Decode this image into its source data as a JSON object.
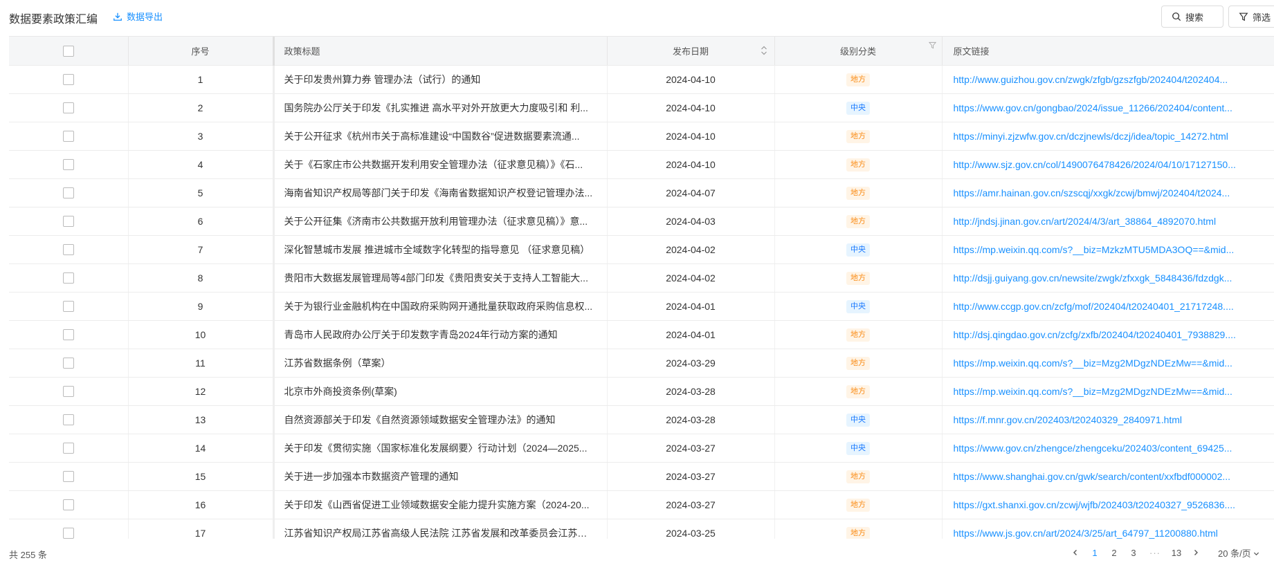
{
  "header": {
    "title": "数据要素政策汇编",
    "export_label": "数据导出",
    "search_label": "搜索",
    "filter_label": "筛选"
  },
  "columns": {
    "no": "序号",
    "title": "政策标题",
    "date": "发布日期",
    "level": "级别分类",
    "link": "原文链接"
  },
  "colors": {
    "accent": "#1890ff",
    "local_text": "#fa8c16",
    "local_bg": "#fff4e6",
    "central_text": "#1677ff",
    "central_bg": "#e6f4ff"
  },
  "rows": [
    {
      "no": "1",
      "title": "关于印发贵州算力券 管理办法（试行）的通知",
      "date": "2024-04-10",
      "level": "地方",
      "link": "http://www.guizhou.gov.cn/zwgk/zfgb/gzszfgb/202404/t202404..."
    },
    {
      "no": "2",
      "title": "国务院办公厅关于印发《扎实推进 高水平对外开放更大力度吸引和 利...",
      "date": "2024-04-10",
      "level": "中央",
      "link": "https://www.gov.cn/gongbao/2024/issue_11266/202404/content..."
    },
    {
      "no": "3",
      "title": "关于公开征求《杭州市关于高标准建设“中国数谷”促进数据要素流通...",
      "date": "2024-04-10",
      "level": "地方",
      "link": "https://minyi.zjzwfw.gov.cn/dczjnewls/dczj/idea/topic_14272.html"
    },
    {
      "no": "4",
      "title": "关于《石家庄市公共数据开发利用安全管理办法（征求意见稿）》《石...",
      "date": "2024-04-10",
      "level": "地方",
      "link": "http://www.sjz.gov.cn/col/1490076478426/2024/04/10/17127150..."
    },
    {
      "no": "5",
      "title": "海南省知识产权局等部门关于印发《海南省数据知识产权登记管理办法...",
      "date": "2024-04-07",
      "level": "地方",
      "link": "https://amr.hainan.gov.cn/szscqj/xxgk/zcwj/bmwj/202404/t2024..."
    },
    {
      "no": "6",
      "title": "关于公开征集《济南市公共数据开放利用管理办法（征求意见稿）》意...",
      "date": "2024-04-03",
      "level": "地方",
      "link": "http://jndsj.jinan.gov.cn/art/2024/4/3/art_38864_4892070.html"
    },
    {
      "no": "7",
      "title": "深化智慧城市发展 推进城市全域数字化转型的指导意见 （征求意见稿）",
      "date": "2024-04-02",
      "level": "中央",
      "link": "https://mp.weixin.qq.com/s?__biz=MzkzMTU5MDA3OQ==&mid..."
    },
    {
      "no": "8",
      "title": "贵阳市大数据发展管理局等4部门印发《贵阳贵安关于支持人工智能大...",
      "date": "2024-04-02",
      "level": "地方",
      "link": "http://dsjj.guiyang.gov.cn/newsite/zwgk/zfxxgk_5848436/fdzdgk..."
    },
    {
      "no": "9",
      "title": "关于为银行业金融机构在中国政府采购网开通批量获取政府采购信息权...",
      "date": "2024-04-01",
      "level": "中央",
      "link": "http://www.ccgp.gov.cn/zcfg/mof/202404/t20240401_21717248...."
    },
    {
      "no": "10",
      "title": "青岛市人民政府办公厅关于印发数字青岛2024年行动方案的通知",
      "date": "2024-04-01",
      "level": "地方",
      "link": "http://dsj.qingdao.gov.cn/zcfg/zxfb/202404/t20240401_7938829...."
    },
    {
      "no": "11",
      "title": "江苏省数据条例（草案）",
      "date": "2024-03-29",
      "level": "地方",
      "link": "https://mp.weixin.qq.com/s?__biz=Mzg2MDgzNDEzMw==&mid..."
    },
    {
      "no": "12",
      "title": "北京市外商投资条例(草案)",
      "date": "2024-03-28",
      "level": "地方",
      "link": "https://mp.weixin.qq.com/s?__biz=Mzg2MDgzNDEzMw==&mid..."
    },
    {
      "no": "13",
      "title": "自然资源部关于印发《自然资源领域数据安全管理办法》的通知",
      "date": "2024-03-28",
      "level": "中央",
      "link": "https://f.mnr.gov.cn/202403/t20240329_2840971.html"
    },
    {
      "no": "14",
      "title": "关于印发《贯彻实施〈国家标准化发展纲要〉行动计划（2024—2025...",
      "date": "2024-03-27",
      "level": "中央",
      "link": "https://www.gov.cn/zhengce/zhengceku/202403/content_69425..."
    },
    {
      "no": "15",
      "title": "关于进一步加强本市数据资产管理的通知",
      "date": "2024-03-27",
      "level": "地方",
      "link": "https://www.shanghai.gov.cn/gwk/search/content/xxfbdf000002..."
    },
    {
      "no": "16",
      "title": "关于印发《山西省促进工业领域数据安全能力提升实施方案（2024-20...",
      "date": "2024-03-27",
      "level": "地方",
      "link": "https://gxt.shanxi.gov.cn/zcwj/wjfb/202403/t20240327_9526836...."
    },
    {
      "no": "17",
      "title": "江苏省知识产权局江苏省高级人民法院 江苏省发展和改革委员会江苏省...",
      "date": "2024-03-25",
      "level": "地方",
      "link": "https://www.js.gov.cn/art/2024/3/25/art_64797_11200880.html"
    }
  ],
  "footer": {
    "total": "共 255 条",
    "pages": [
      "1",
      "2",
      "3"
    ],
    "ellipsis": "···",
    "last_page": "13",
    "current_page": "1",
    "page_size": "20 条/页"
  },
  "icons": {
    "export": "download-icon",
    "search": "search-icon",
    "filter": "filter-icon",
    "sort": "sort-icon",
    "prev": "chevron-left-icon",
    "next": "chevron-right-icon",
    "dropdown": "chevron-down-icon"
  }
}
